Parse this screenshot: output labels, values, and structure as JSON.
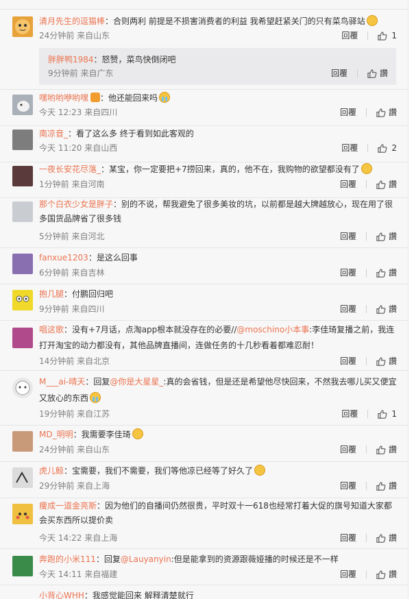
{
  "ui": {
    "reply": "回覆",
    "like_label": "讚"
  },
  "colors": {
    "username": "#eb7350",
    "meta": "#808080",
    "subbox_bg": "#eaeaec"
  },
  "comments": [
    {
      "user": "清月先生的逗猫棒",
      "text": "：合则两利 前提是不损害消费者的利益 我希望赶紧关门的只有菜鸟驿站",
      "emoji": "sweat-emoji",
      "meta": "24分钟前 来自山东",
      "likes": "1",
      "avatar_color": "#e8a23a"
    },
    {
      "user": "胖胖鸭1984",
      "text": "：怒赞，菜鸟快倒闭吧",
      "meta": "9分钟前 来自广东",
      "likes": ""
    },
    {
      "user": "嘿哟哟咿哟嘿",
      "text": "：他还能回来吗",
      "badge": "vip-badge-icon",
      "emoji": "cry-emoji",
      "meta": "今天 12:23 来自四川",
      "likes": "",
      "avatar_color": "#a9b0b8"
    },
    {
      "user": "南凉音_",
      "text": "：看了这么多 终于看到如此客观的",
      "meta": "今天 11:20 来自山西",
      "likes": "2",
      "avatar_color": "#7d7d7d"
    },
    {
      "user": "一夜长安花尽落_",
      "text": "：某宝，你一定要把+7捞回来，真的，他不在，我购物的欲望都没有了",
      "emoji": "laugh-emoji",
      "meta": "1分钟前 来自河南",
      "likes": "",
      "avatar_color": "#5a3a3a"
    },
    {
      "user": "那个白衣少女是胖子",
      "text": "：别的不说，帮我避免了很多美妆的坑，以前都是越大牌越放心，现在用了很多国货品牌省了很多钱",
      "meta": "5分钟前 来自河北",
      "likes": "",
      "avatar_color": "#c9cdd2"
    },
    {
      "user": "fanxue1203",
      "text": "：是这么回事",
      "meta": "6分钟前 来自吉林",
      "likes": "",
      "avatar_color": "#8a6fb0"
    },
    {
      "user": "抱几腿",
      "text": "：付鹏回归吧",
      "meta": "9分钟前 来自四川",
      "likes": "",
      "avatar_color": "#f0d92a"
    },
    {
      "user": "唱这歌",
      "text": "：没有+7月话，点淘app根本就没存在的必要//",
      "at1": "@moschino小本事",
      "text2": ":李佳琦复播之前，我连打开淘宝的动力都没有，其他品牌直播间，连做任务的十几秒看着都难忍耐！",
      "meta": "14分钟前 来自北京",
      "likes": "",
      "avatar_color": "#b04a8a"
    },
    {
      "user": "M___ai-晴天",
      "text": "：回复",
      "at1": "@你是大星星_",
      "text2": ":真的会省钱，但是还是希望他尽快回来，不然我去哪儿买又便宜又放心的东西",
      "emoji": "cry-emoji",
      "meta": "19分钟前 来自江苏",
      "likes": "1",
      "avatar_color": "#e8e8e8"
    },
    {
      "user": "MD_明明",
      "text": "：我需要李佳琦",
      "emoji": "shy-emoji",
      "meta": "24分钟前 来自山东",
      "likes": "",
      "avatar_color": "#c89a7a"
    },
    {
      "user": "虎儿鲸",
      "text": "：宝需要，我们不需要，我们等他凉已经等了好久了",
      "emoji": "smile-emoji",
      "meta": "29分钟前 来自上海",
      "likes": "",
      "avatar_color": "#dcdcdc"
    },
    {
      "user": "痩成一道金亮斯",
      "text": "：因为他们的自播间仍然很贵，平时双十一618也经常打着大促的旗号知道大家都会买东西所以提价卖",
      "meta": "今天 14:22 来自上海",
      "likes": "",
      "avatar_color": "#f0c040"
    },
    {
      "user": "奔跑的小米111",
      "text": "：回复",
      "at1": "@Lauyanyin",
      "text2": ":但是能拿到的资源跟薇娅播的时候还是不一样",
      "meta": "今天 14:11 来自福建",
      "likes": "",
      "avatar_color": "#3a8a4a"
    },
    {
      "user": "小背心WHH",
      "text": "：我感觉能回来 解释清楚就行",
      "meta": "",
      "likes": ""
    }
  ]
}
